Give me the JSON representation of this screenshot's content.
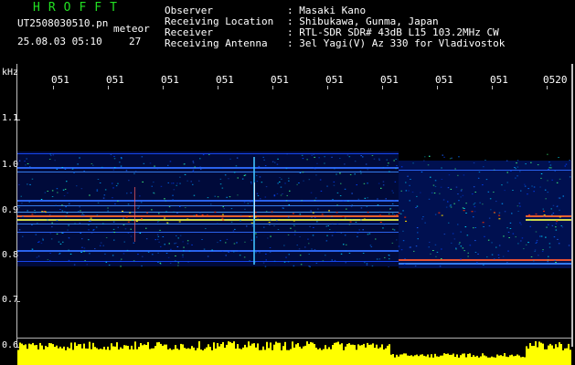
{
  "header": {
    "app_name": "HROFFT",
    "file_name": "UT2508030510.pn",
    "mode": "meteor",
    "datetime": "25.08.03 05:10",
    "count": "27"
  },
  "info": [
    {
      "label": "Observer",
      "value": ": Masaki Kano"
    },
    {
      "label": "Receiving Location",
      "value": ": Shibukawa, Gunma, Japan"
    },
    {
      "label": "Receiver",
      "value": ": RTL-SDR SDR# 43dB L15 103.2MHz CW"
    },
    {
      "label": "Receiving Antenna",
      "value": ": 3el Yagi(V) Az 330 for Vladivostok"
    }
  ],
  "axis": {
    "unit": "kHz",
    "y_ticks": [
      "1.1",
      "1.0",
      "0.9",
      "0.8",
      "0.7",
      "0.6"
    ],
    "x_ticks": [
      "051",
      "051",
      "051",
      "051",
      "051",
      "051",
      "051",
      "051",
      "051",
      "0520"
    ]
  },
  "colors": {
    "title_green": "#22e022",
    "background": "#000000",
    "noise_blue": "#0033cc",
    "signal_red": "#ff3300",
    "power_yellow": "#ffff00"
  }
}
